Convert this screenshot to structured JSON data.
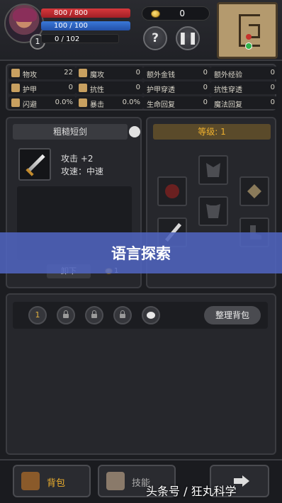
{
  "player": {
    "level": "1",
    "hp": "800 / 800",
    "mp": "100 / 100",
    "xp": "0 / 102",
    "hp_fraction": 1.0,
    "mp_fraction": 1.0,
    "xp_fraction": 0.0,
    "gold": "0"
  },
  "stats": [
    {
      "label": "物攻",
      "value": "22",
      "icon": "sword-icon",
      "color": "#c8a060"
    },
    {
      "label": "魔攻",
      "value": "0",
      "icon": "magic-hand-icon",
      "color": "#c8a060"
    },
    {
      "label": "额外金钱",
      "value": "0",
      "icon": "",
      "color": ""
    },
    {
      "label": "额外经验",
      "value": "0",
      "icon": "",
      "color": ""
    },
    {
      "label": "护甲",
      "value": "0",
      "icon": "armor-icon",
      "color": "#c8a060"
    },
    {
      "label": "抗性",
      "value": "0",
      "icon": "resist-icon",
      "color": "#c8a060"
    },
    {
      "label": "护甲穿透",
      "value": "0",
      "icon": "",
      "color": ""
    },
    {
      "label": "抗性穿透",
      "value": "0",
      "icon": "",
      "color": ""
    },
    {
      "label": "闪避",
      "value": "0.0%",
      "icon": "dodge-icon",
      "color": "#c8a060"
    },
    {
      "label": "暴击",
      "value": "0.0%",
      "icon": "crit-icon",
      "color": "#c8a060"
    },
    {
      "label": "生命回复",
      "value": "0",
      "icon": "",
      "color": ""
    },
    {
      "label": "魔法回复",
      "value": "0",
      "icon": "",
      "color": ""
    }
  ],
  "item": {
    "name": "粗糙短剑",
    "attack": "攻击 +2",
    "speed": "攻速：中速",
    "unequip_label": "卸下",
    "cost": "1"
  },
  "slots": {
    "title": "等级: 1"
  },
  "banner": {
    "text": "语言探索"
  },
  "inventory": {
    "tab1": "1",
    "sort_label": "整理背包"
  },
  "nav": {
    "bag": "背包",
    "skills": "技能"
  },
  "watermark": "头条号 / 狂丸科学",
  "colors": {
    "accent": "#f0b12e",
    "hp": "#d8383c",
    "mp": "#3a78d8",
    "banner": "#5064be"
  }
}
